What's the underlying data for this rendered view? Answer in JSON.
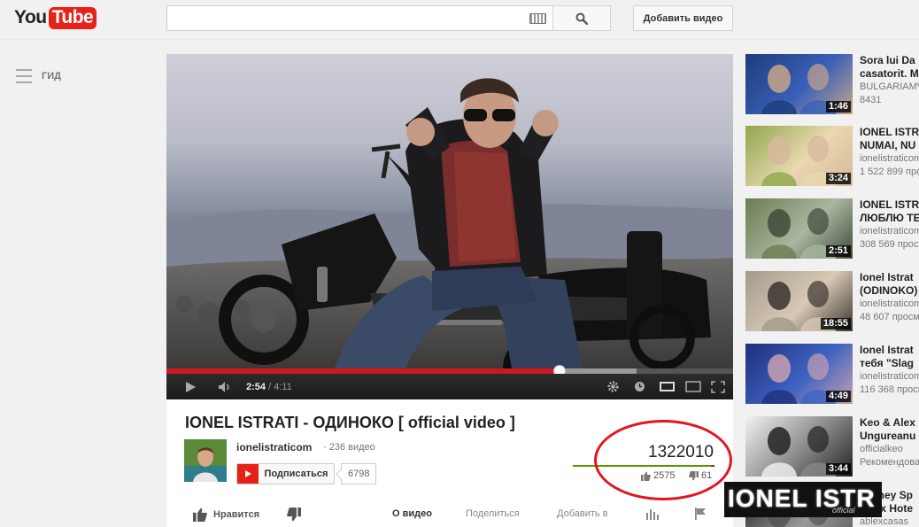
{
  "masthead": {
    "logo_you": "You",
    "logo_tube": "Tube",
    "search_placeholder": "",
    "upload_label": "Добавить видео"
  },
  "guide": {
    "label": "ГИД"
  },
  "player": {
    "time_current": "2:54",
    "time_separator": " / ",
    "time_total": "4:11",
    "played_fraction": 0.694,
    "buffered_fraction": 0.83
  },
  "video": {
    "title": "IONEL ISTRATI - ОДИНОКО [ official video ]",
    "channel": "ionelistraticom",
    "video_count": "· 236 видео",
    "subscribe_label": "Подписаться",
    "subscriber_count": "6798",
    "views": "1322010",
    "likes": "2575",
    "dislikes": "61",
    "like_fraction": 0.977
  },
  "actions": {
    "like_label": "Нравится",
    "about_tab": "О видео",
    "share_tab": "Поделиться",
    "add_to_tab": "Добавить в"
  },
  "related": [
    {
      "title_1": "Sora lui Da",
      "title_2": "casatorit. M",
      "channel": "BULGARIAMV",
      "views": "8431",
      "duration": "1:46",
      "colors": [
        "#1d3d7a",
        "#c8a58a",
        "#3a5fb8"
      ]
    },
    {
      "title_1": "IONEL ISTR",
      "title_2": "NUMAI, NU",
      "channel": "ionelistraticom",
      "views": "1 522 899 прос",
      "duration": "3:24",
      "colors": [
        "#8fa74c",
        "#d6b89a",
        "#e9d8b0"
      ]
    },
    {
      "title_1": "IONEL ISTR",
      "title_2": "ЛЮБЛЮ ТЕ",
      "channel": "ionelistraticom",
      "views": "308 569 просм",
      "duration": "2:51",
      "colors": [
        "#6b7d52",
        "#3f4a3a",
        "#a9b7a0"
      ]
    },
    {
      "title_1": "Ionel Istrat",
      "title_2": "(ODINOKO)",
      "channel": "ionelistraticom",
      "views": "48 607 просм",
      "duration": "18:55",
      "colors": [
        "#a39a8a",
        "#3a3330",
        "#d8c9b6"
      ]
    },
    {
      "title_1": "Ionel Istrat",
      "title_2": "тебя \"Slag",
      "channel": "ionelistraticom",
      "views": "116 368 просм",
      "duration": "4:49",
      "colors": [
        "#1f2f7a",
        "#c9a0b0",
        "#3e62c2"
      ]
    },
    {
      "title_1": "Keo & Alex",
      "title_2": "Ungureanu",
      "channel": "officialkeo",
      "views": "Рекомендова",
      "duration": "3:44",
      "colors": [
        "#f2f2f2",
        "#222222",
        "#888888"
      ]
    },
    {
      "title_1": "Britney Sp",
      "title_2": "Onyx Hote",
      "channel": "ablexcasas",
      "views": "",
      "duration": "",
      "colors": [
        "#222222",
        "#555555",
        "#999999"
      ]
    }
  ],
  "overlay": {
    "text": "IONEL ISTR",
    "sub": "official"
  }
}
